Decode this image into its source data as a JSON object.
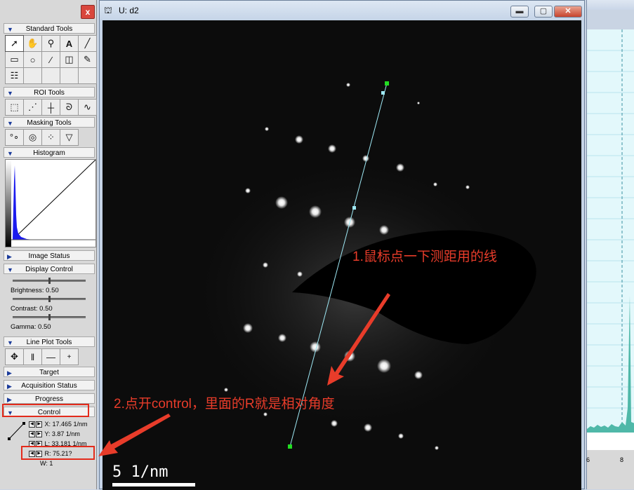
{
  "palette": {
    "close_label": "x",
    "sections": {
      "standard_tools": "Standard Tools",
      "roi_tools": "ROI Tools",
      "masking_tools": "Masking Tools",
      "histogram": "Histogram",
      "image_status": "Image Status",
      "display_control": "Display Control",
      "line_plot_tools": "Line Plot Tools",
      "target": "Target",
      "acquisition_status": "Acquisition Status",
      "progress": "Progress",
      "control": "Control"
    },
    "display": {
      "brightness": "Brightness: 0.50",
      "contrast": "Contrast: 0.50",
      "gamma": "Gamma: 0.50",
      "brightness_level": 0.5,
      "contrast_level": 0.5,
      "gamma_level": 0.5
    },
    "control": {
      "x": "X: 17.465 1/nm",
      "y": "Y: 3.87 1/nm",
      "l": "L: 33.181 1/nm",
      "r": "R: 75.21?",
      "w": "W: 1"
    }
  },
  "image_window": {
    "title": "U: d2",
    "scale_label": "5  1/nm"
  },
  "annotations": {
    "a1": "1.鼠标点一下测距用的线",
    "a2": "2.点开control，里面的R就是相对角度"
  },
  "right_window": {
    "tick_6": "6",
    "tick_8": "8"
  },
  "colors": {
    "annotation": "#e83c2a",
    "line": "#9fe9f5",
    "endpoint": "#22dd22"
  }
}
